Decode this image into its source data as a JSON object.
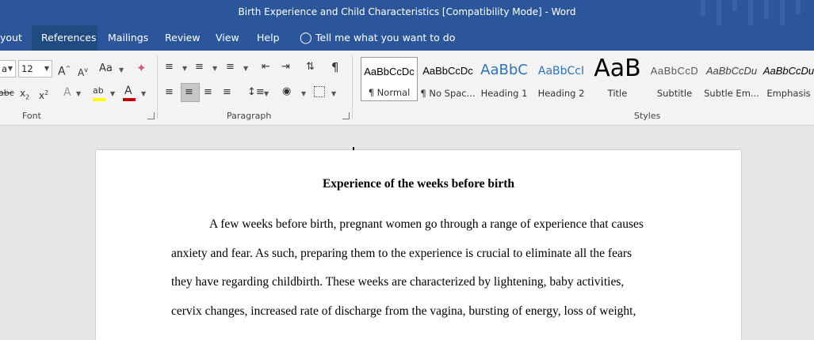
{
  "titlebar": {
    "title": "Birth Experience and Child Characteristics [Compatibility Mode]  -  Word"
  },
  "menu": {
    "tabs": [
      "yout",
      "References",
      "Mailings",
      "Review",
      "View",
      "Help"
    ],
    "active_tab": "References",
    "tell_me": "Tell me what you want to do"
  },
  "font_group": {
    "font_name": "a",
    "font_size": "12",
    "label": "Font",
    "icons": [
      "grow-font-icon",
      "shrink-font-icon",
      "change-case-icon",
      "clear-formatting-icon",
      "strikethrough-icon",
      "subscript-icon",
      "superscript-icon",
      "text-effects-icon",
      "highlight-icon",
      "font-color-icon"
    ],
    "highlight_color": "#ffff00",
    "font_color": "#c00000"
  },
  "paragraph_group": {
    "label": "Paragraph",
    "icons": [
      "bullets-icon",
      "numbering-icon",
      "multilevel-list-icon",
      "decrease-indent-icon",
      "increase-indent-icon",
      "sort-icon",
      "show-marks-icon",
      "align-left-icon",
      "center-icon",
      "align-right-icon",
      "justify-icon",
      "line-spacing-icon",
      "shading-icon",
      "borders-icon"
    ]
  },
  "styles_group": {
    "label": "Styles",
    "items": [
      {
        "preview": "AaBbCcDc",
        "name": "¶ Normal",
        "selected": true
      },
      {
        "preview": "AaBbCcDc",
        "name": "¶ No Spac...",
        "selected": false
      },
      {
        "preview": "AaBbC",
        "name": "Heading 1",
        "selected": false
      },
      {
        "preview": "AaBbCcI",
        "name": "Heading 2",
        "selected": false
      },
      {
        "preview": "AaB",
        "name": "Title",
        "selected": false
      },
      {
        "preview": "AaBbCcD",
        "name": "Subtitle",
        "selected": false
      },
      {
        "preview": "AaBbCcDu",
        "name": "Subtle Em...",
        "selected": false
      },
      {
        "preview": "AaBbCcDu",
        "name": "Emphasis",
        "selected": false
      }
    ]
  },
  "document": {
    "heading": "Experience of the weeks before birth",
    "lines": [
      "A few weeks before birth, pregnant women go through a range of experience that causes",
      "anxiety and fear. As such, preparing them to the experience is crucial to eliminate all the fears",
      "they have regarding childbirth. These weeks are characterized by lightening, baby activities,",
      "cervix changes, increased rate of discharge from the vagina, bursting of energy, loss of weight,"
    ]
  },
  "colors": {
    "word_blue": "#2b579a",
    "active_tab": "#1f4a82",
    "ribbon_bg": "#f3f3f3",
    "canvas_bg": "#e6e6e6"
  }
}
